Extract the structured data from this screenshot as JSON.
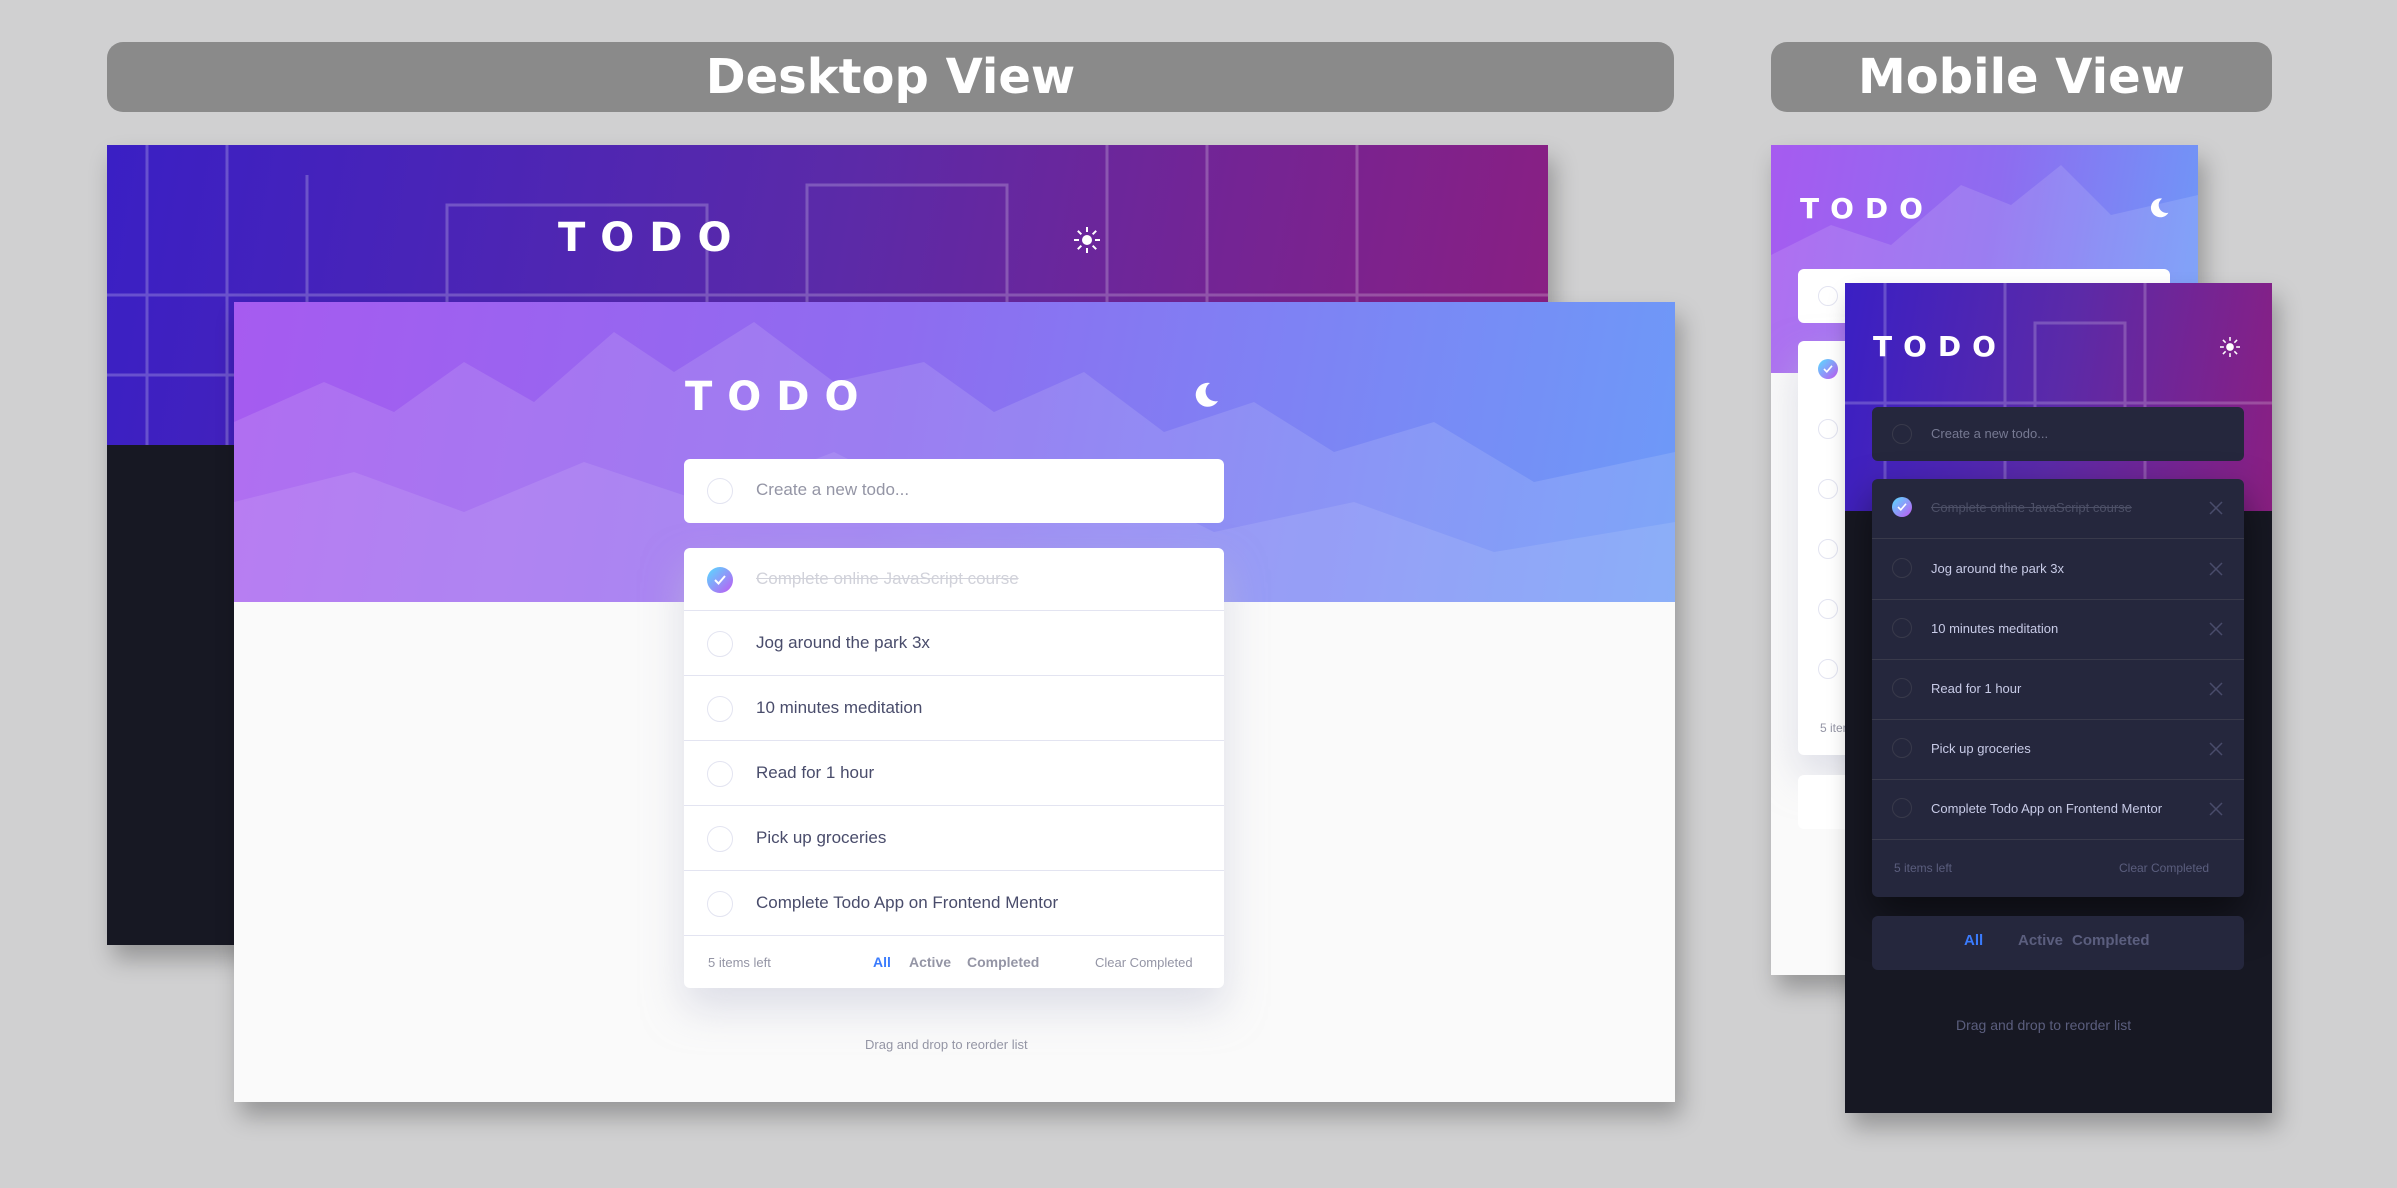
{
  "labels": {
    "desktop": "Desktop View",
    "mobile": "Mobile View"
  },
  "app": {
    "logo": "TODO",
    "placeholder": "Create a new todo...",
    "todos": [
      {
        "text": "Complete online JavaScript course",
        "completed": true
      },
      {
        "text": "Jog around the park 3x",
        "completed": false
      },
      {
        "text": "10 minutes meditation",
        "completed": false
      },
      {
        "text": "Read for 1 hour",
        "completed": false
      },
      {
        "text": "Pick up groceries",
        "completed": false
      },
      {
        "text": "Complete Todo App on Frontend Mentor",
        "completed": false
      }
    ],
    "items_left": "5 items left",
    "filters": {
      "all": "All",
      "active": "Active",
      "completed": "Completed"
    },
    "active_filter": "all",
    "clear": "Clear Completed",
    "hint": "Drag and drop to reorder list",
    "partial_items_left": "5 items"
  },
  "icons": {
    "sun": "sun-icon",
    "moon": "moon-icon",
    "check": "check-icon",
    "close": "close-icon"
  },
  "colors": {
    "page_bg": "#d0d0d1",
    "banner_bg": "#8a8a8a",
    "accent": "#3a7bfd",
    "light_bg": "#fafafa",
    "dark_bg": "#171823",
    "dark_card": "#25273d",
    "check_gradient_start": "#57ddff",
    "check_gradient_end": "#c058f3"
  }
}
